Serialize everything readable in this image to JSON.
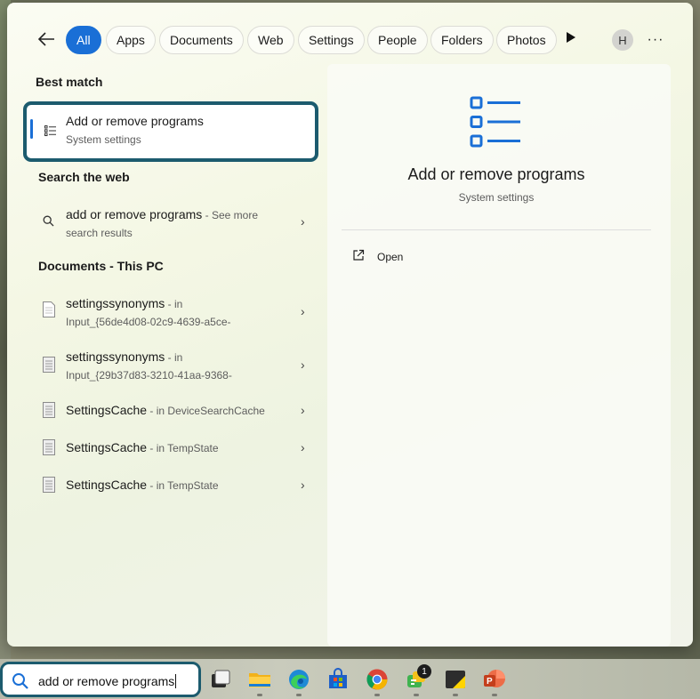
{
  "filters": {
    "back_icon": "back-arrow-icon",
    "chips": [
      {
        "label": "All",
        "active": true
      },
      {
        "label": "Apps"
      },
      {
        "label": "Documents"
      },
      {
        "label": "Web"
      },
      {
        "label": "Settings"
      },
      {
        "label": "People"
      },
      {
        "label": "Folders"
      },
      {
        "label": "Photos"
      }
    ],
    "more_chips_icon": "play-icon",
    "avatar_initial": "H",
    "more_options_label": "···"
  },
  "results": {
    "best_match_heading": "Best match",
    "best_match": {
      "title": "Add or remove programs",
      "subtitle": "System settings",
      "icon": "list-icon"
    },
    "web_heading": "Search the web",
    "web_result": {
      "title": "add or remove programs",
      "meta": " - See more",
      "subtitle": "search results",
      "icon": "search-icon"
    },
    "documents_heading": "Documents - This PC",
    "documents": [
      {
        "title": "settingssynonyms",
        "meta": " - in",
        "subtitle": "Input_{56de4d08-02c9-4639-a5ce-"
      },
      {
        "title": "settingssynonyms",
        "meta": " - in",
        "subtitle": "Input_{29b37d83-3210-41aa-9368-"
      },
      {
        "title": "SettingsCache",
        "meta": " - in DeviceSearchCache",
        "subtitle": ""
      },
      {
        "title": "SettingsCache",
        "meta": " - in TempState",
        "subtitle": ""
      },
      {
        "title": "SettingsCache",
        "meta": " - in TempState",
        "subtitle": ""
      }
    ]
  },
  "preview": {
    "title": "Add or remove programs",
    "subtitle": "System settings",
    "open_label": "Open",
    "accent_color": "#1a6fd6"
  },
  "taskbar": {
    "search_value": "add or remove programs",
    "teams_badge": "1",
    "icons": [
      "task-view-icon",
      "file-explorer-icon",
      "edge-icon",
      "store-icon",
      "chrome-icon",
      "teams-chat-icon",
      "sticky-notes-icon",
      "powerpoint-icon"
    ]
  }
}
